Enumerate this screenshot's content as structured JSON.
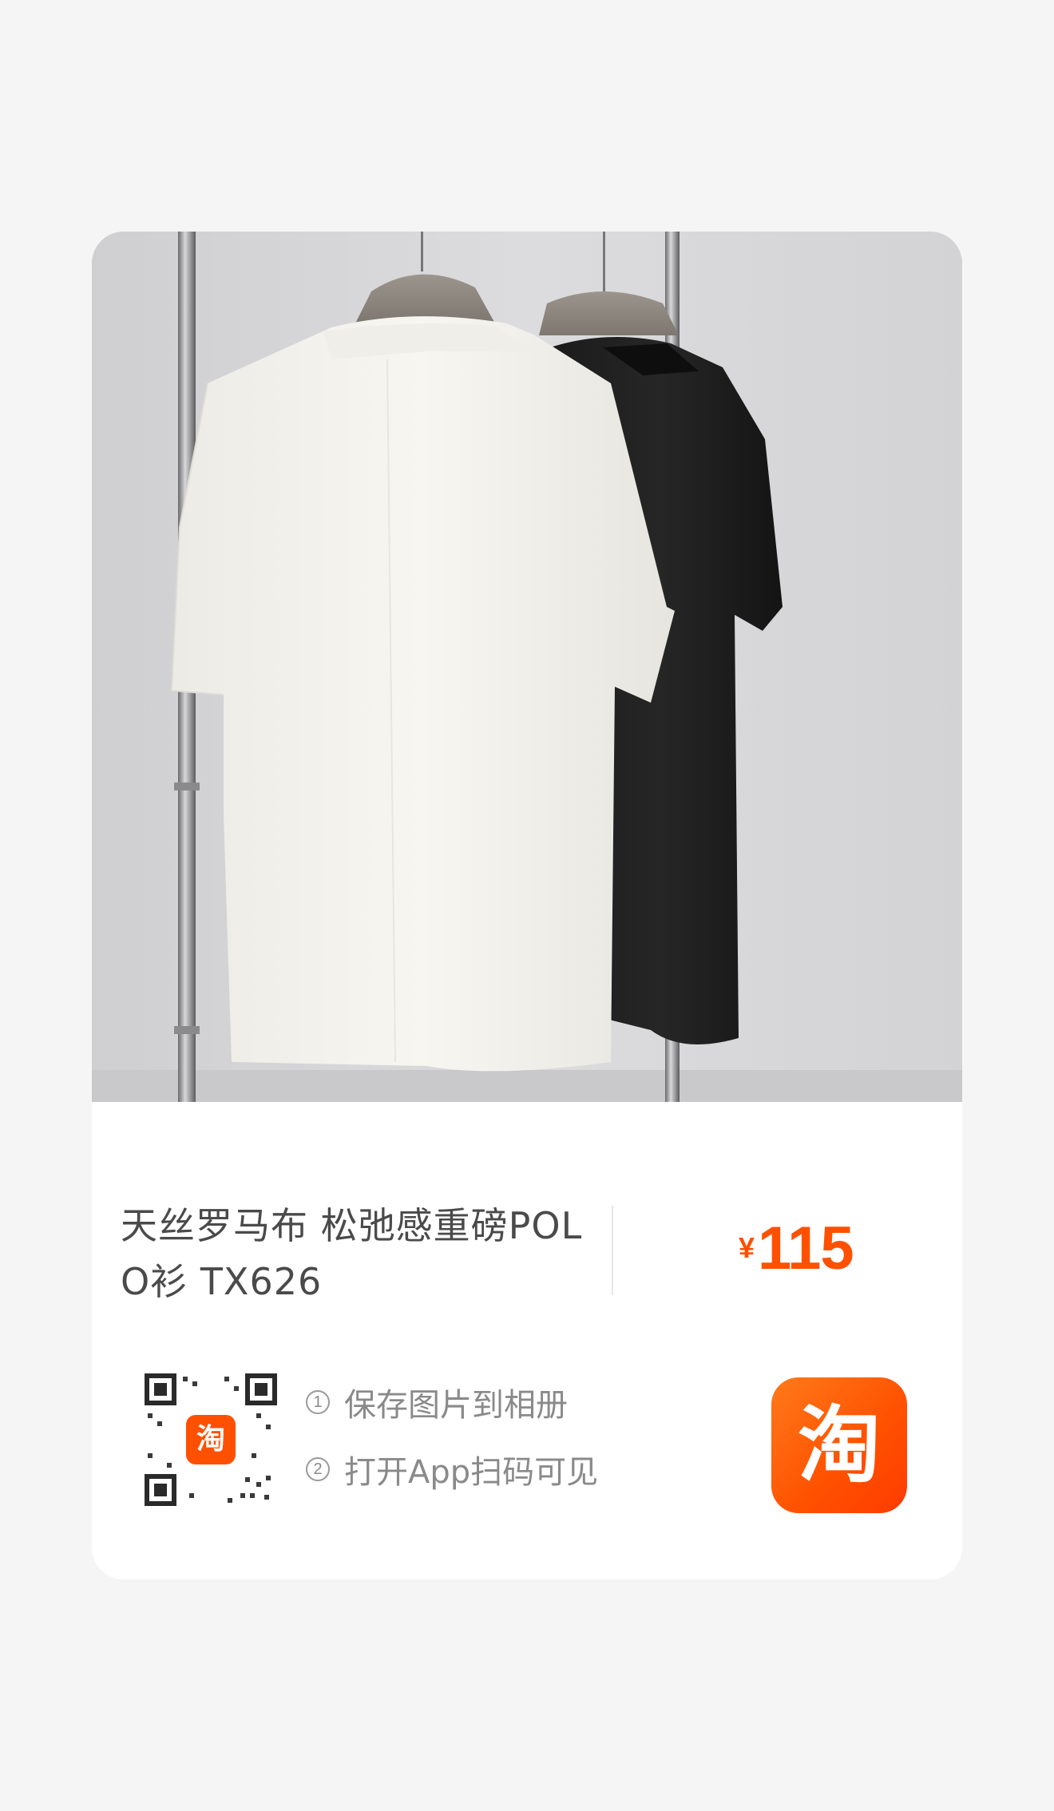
{
  "product": {
    "title": "天丝罗马布 松弛感重磅POLO衫 TX626",
    "currency": "¥",
    "price": "115",
    "image_alt": "white and black polo shirts on hangers"
  },
  "share": {
    "step1_num": "1",
    "step1": "保存图片到相册",
    "step2_num": "2",
    "step2": "打开App扫码可见",
    "qr_badge": "淘"
  },
  "app": {
    "logo_text": "淘",
    "accent": "#ff5000"
  }
}
